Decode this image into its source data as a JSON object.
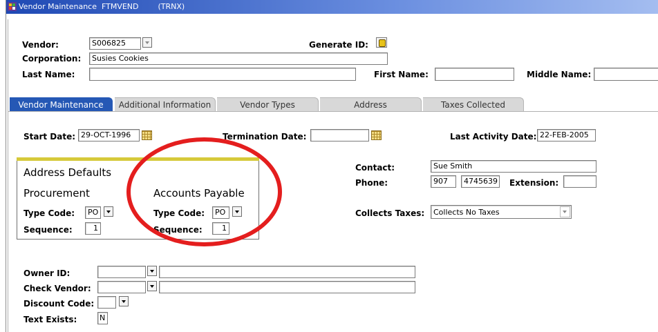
{
  "window": {
    "title": "Vendor Maintenance  FTMVEND        (TRNX)"
  },
  "key_block": {
    "vendor_label": "Vendor:",
    "vendor_value": "S006825",
    "generate_id_label": "Generate ID:",
    "corporation_label": "Corporation:",
    "corporation_value": "Susies Cookies",
    "last_name_label": "Last Name:",
    "last_name_value": "",
    "first_name_label": "First Name:",
    "first_name_value": "",
    "middle_name_label": "Middle Name:",
    "middle_name_value": ""
  },
  "tabs": [
    {
      "label": "Vendor Maintenance",
      "active": true
    },
    {
      "label": "Additional Information",
      "active": false
    },
    {
      "label": "Vendor Types",
      "active": false
    },
    {
      "label": "Address",
      "active": false
    },
    {
      "label": "Taxes Collected",
      "active": false
    }
  ],
  "dates": {
    "start_label": "Start Date:",
    "start_value": "29-OCT-1996",
    "termination_label": "Termination Date:",
    "termination_value": "",
    "last_activity_label": "Last Activity Date:",
    "last_activity_value": "22-FEB-2005"
  },
  "address_defaults": {
    "heading": "Address Defaults",
    "procurement": {
      "heading": "Procurement",
      "type_code_label": "Type Code:",
      "type_code_value": "PO",
      "sequence_label": "Sequence:",
      "sequence_value": "1"
    },
    "accounts_payable": {
      "heading": "Accounts Payable",
      "type_code_label": "Type Code:",
      "type_code_value": "PO",
      "sequence_label": "Sequence:",
      "sequence_value": "1"
    }
  },
  "contact": {
    "contact_label": "Contact:",
    "contact_value": "Sue Smith",
    "phone_label": "Phone:",
    "phone_area": "907",
    "phone_number": "4745639",
    "extension_label": "Extension:",
    "extension_value": "",
    "collects_taxes_label": "Collects Taxes:",
    "collects_taxes_value": "Collects No Taxes"
  },
  "other": {
    "owner_id_label": "Owner ID:",
    "owner_id_value": "",
    "owner_name_value": "",
    "check_vendor_label": "Check Vendor:",
    "check_vendor_value": "",
    "check_vendor_name_value": "",
    "discount_code_label": "Discount Code:",
    "discount_code_value": "",
    "text_exists_label": "Text Exists:",
    "text_exists_value": "N"
  },
  "annotation": {
    "oval_color": "#e41e1e"
  },
  "colors": {
    "titlebar": "#1f49b4",
    "active_tab": "#2558b5",
    "panel_accent": "#d6c93a"
  }
}
